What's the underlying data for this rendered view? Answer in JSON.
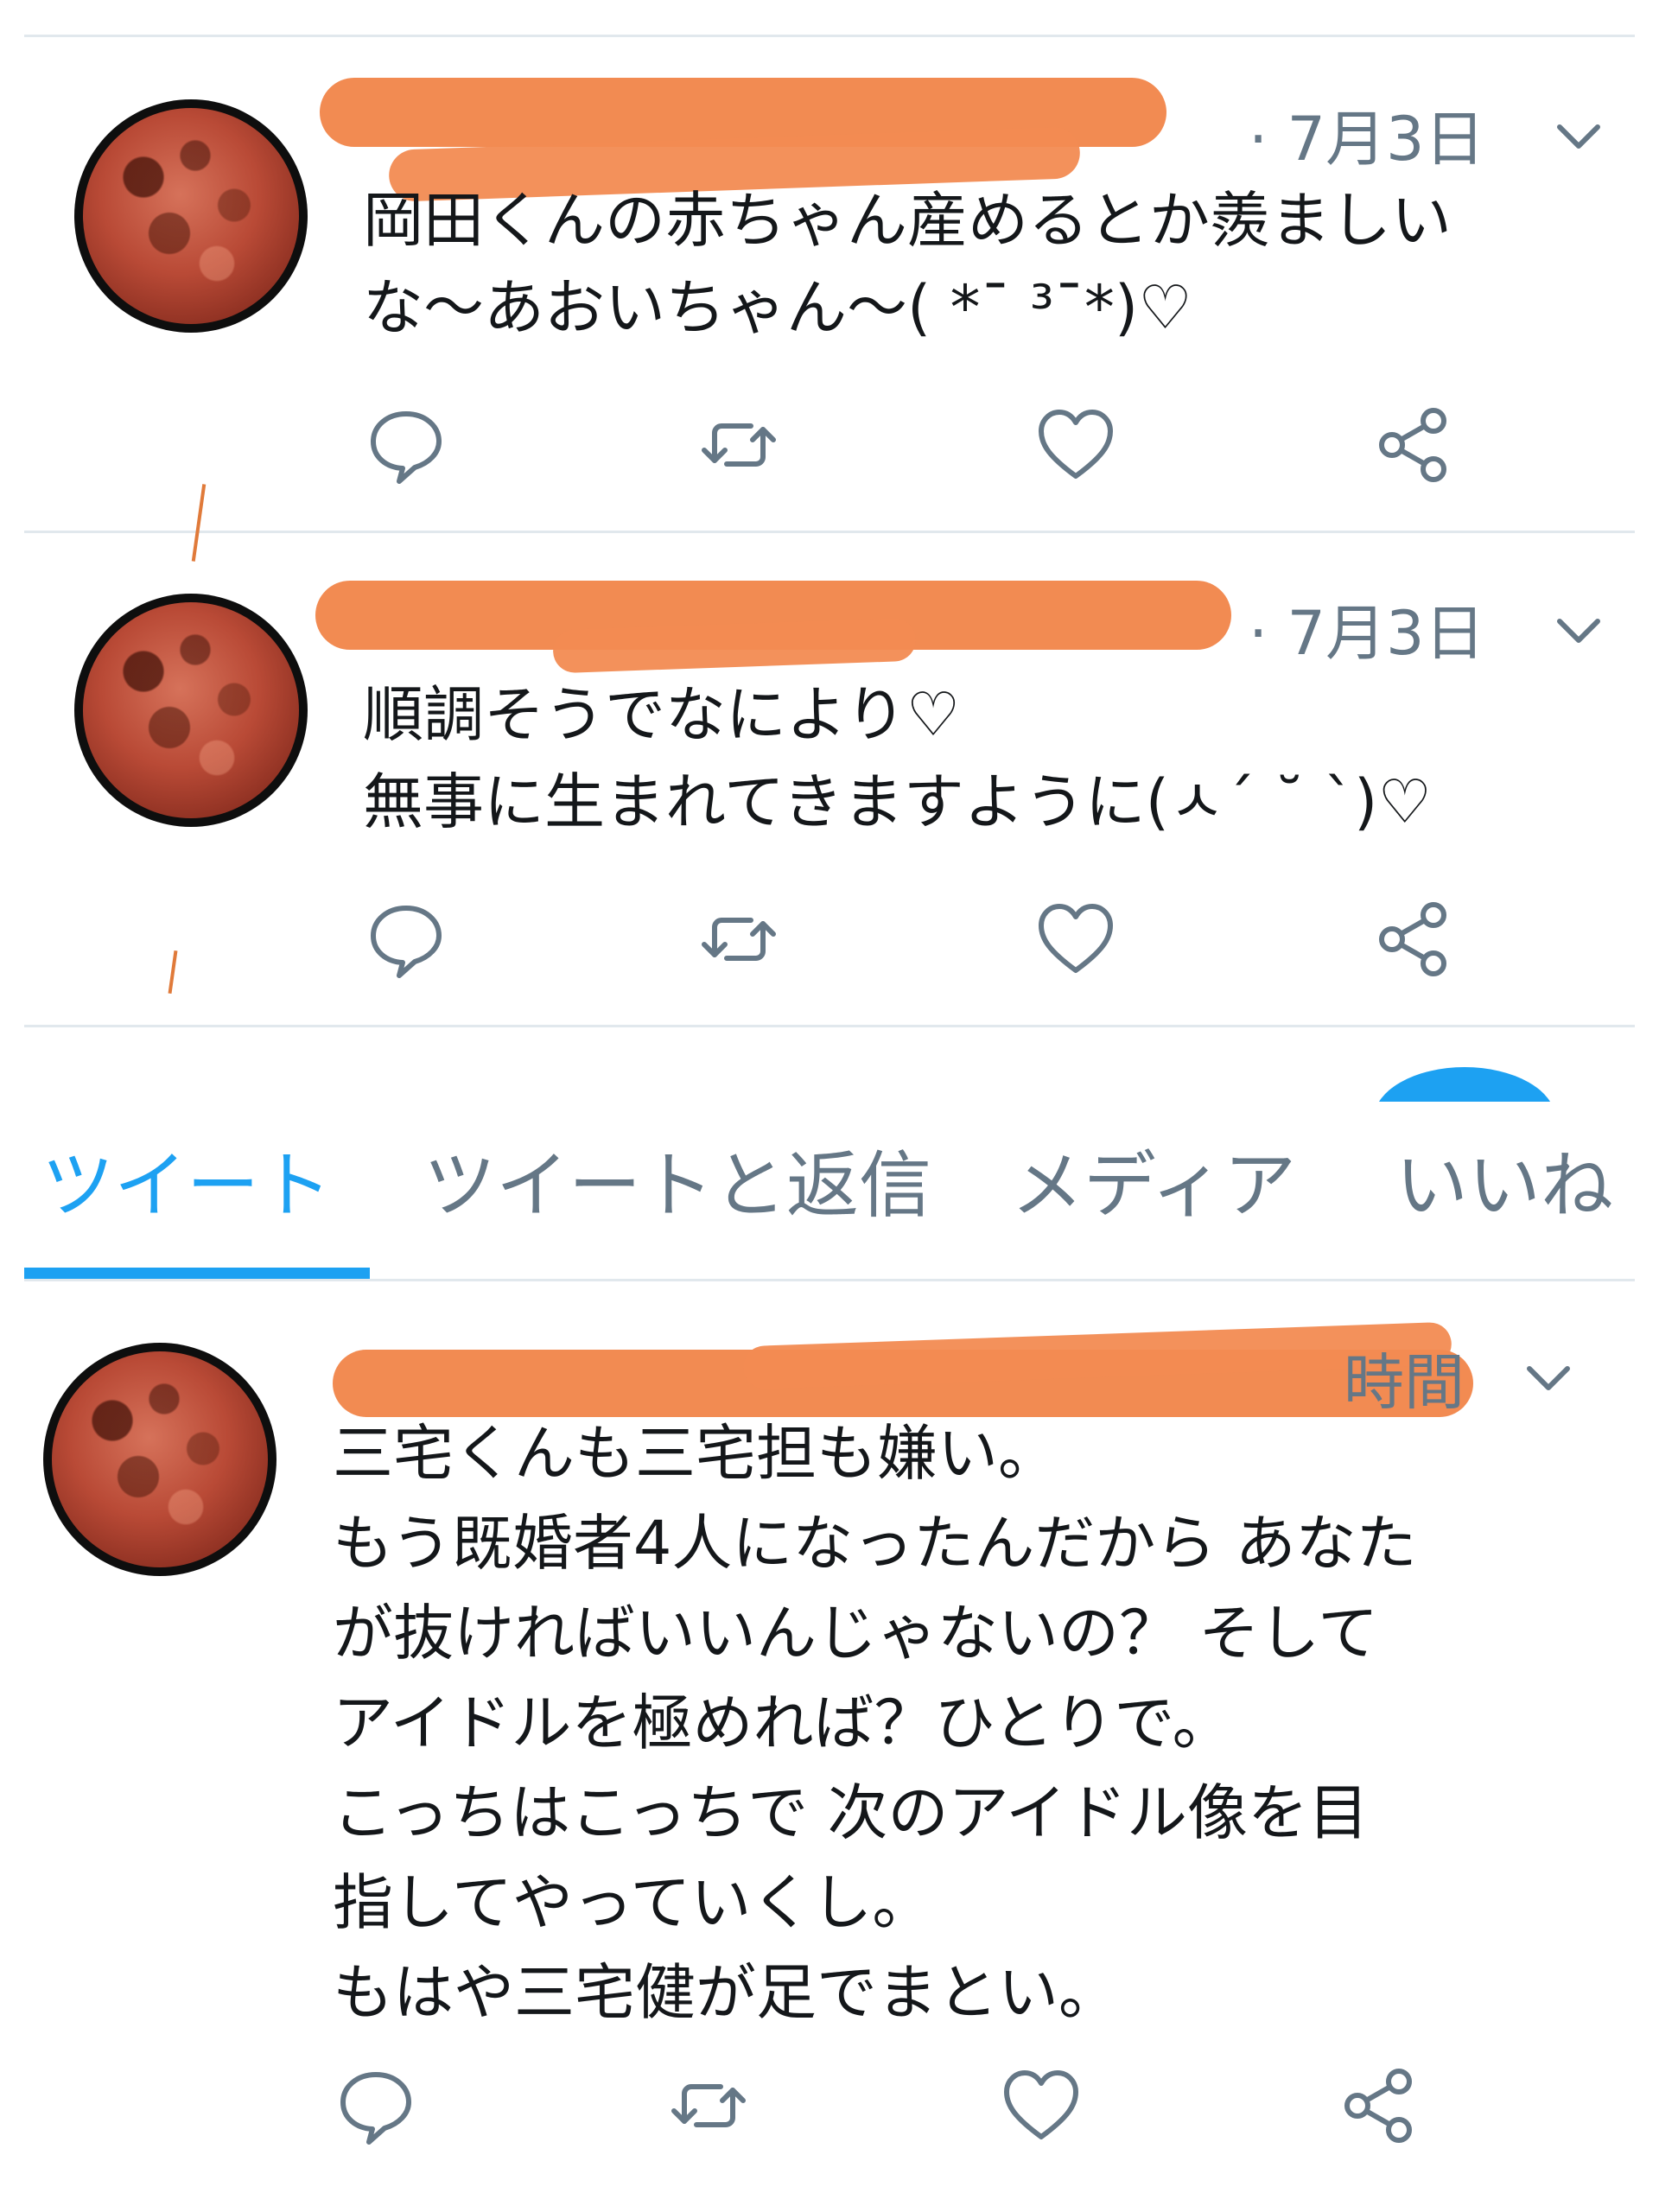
{
  "tweets": [
    {
      "timestamp": "· 7月3日",
      "lines": [
        "岡田くんの赤ちゃん産めるとか羨ましい",
        "な〜あおいちゃん〜( *¯ ³¯*)♡"
      ]
    },
    {
      "timestamp": "· 7月3日",
      "lines": [
        "順調そうでなにより♡",
        "無事に生まれてきますように(ㅅ´ ˘ `)♡"
      ]
    },
    {
      "timestamp": "時間",
      "lines": [
        "三宅くんも三宅担も嫌い。",
        "もう既婚者4人になったんだから あなた",
        "が抜ければいいんじゃないの？ そして",
        "アイドルを極めれば？ひとりで。",
        "こっちはこっちで 次のアイドル像を目",
        "指してやっていくし。",
        "もはや三宅健が足でまとい。"
      ]
    }
  ],
  "tabs": [
    "ツイート",
    "ツイートと返信",
    "メディア",
    "いいね"
  ],
  "active_tab": "ツイート",
  "colors": {
    "accent": "#1da1f2",
    "secondary_text": "#657786",
    "redaction": "#f28b52",
    "divider": "#e1e8ed"
  },
  "icons": [
    "reply-icon",
    "retweet-icon",
    "like-icon",
    "share-icon",
    "caret-down-icon"
  ]
}
